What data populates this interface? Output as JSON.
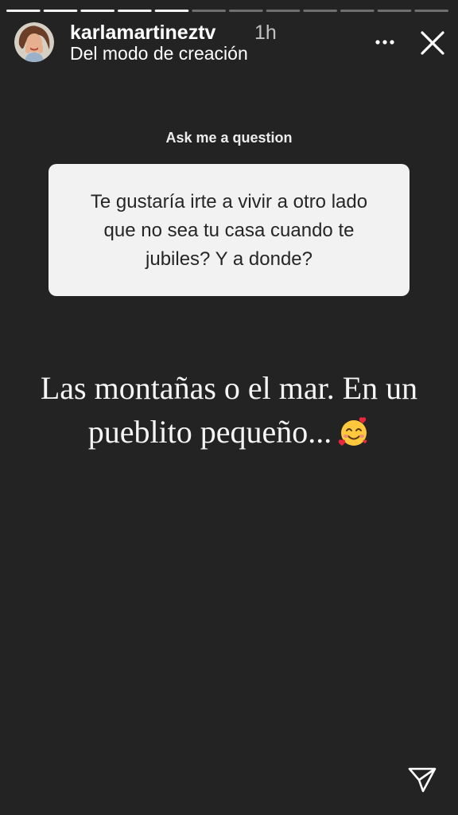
{
  "story": {
    "progress": {
      "segments": 12,
      "completed": 5
    }
  },
  "header": {
    "username": "karlamartineztv",
    "timestamp": "1h",
    "subtitle": "Del modo de creación",
    "icons": {
      "avatar": "avatar-photo",
      "more": "more-horizontal-icon",
      "close": "close-icon"
    }
  },
  "question_sticker": {
    "prompt": "Ask me a question",
    "question": "Te gustaría irte a vivir a otro lado que no sea tu casa cuando te jubiles? Y a donde?"
  },
  "answer": {
    "text": "Las montañas o el mar. En un pueblito pequeño...",
    "emoji": "smiling-face-with-hearts"
  },
  "footer": {
    "send_icon": "send-icon"
  },
  "colors": {
    "background": "#232323",
    "card": "#f2f2f2",
    "card_text": "#262626",
    "text": "#ffffff"
  }
}
